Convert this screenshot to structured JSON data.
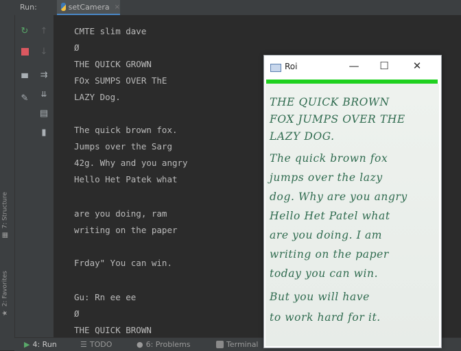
{
  "run_bar": {
    "label": "Run:",
    "tab_title": "setCamera",
    "tab_close": "×"
  },
  "side_tabs": {
    "structure": "7: Structure",
    "favorites": "2: Favorites"
  },
  "console": {
    "lines": [
      "CMTE slim dave",
      "Ø",
      "THE QUICK GROWN",
      "FOx SUMPS OVER ThE",
      "LAZY Dog.",
      "",
      "The quick brown fox.",
      "Jumps over the Sarg",
      "42g. Why and you angry",
      "Hello Het Patek what",
      "",
      "are you doing, ram",
      "writing on the paper",
      "",
      "Frday\" You can win.",
      "",
      "Gu: Rn ee ee",
      "Ø",
      "THE QUICK BROWN"
    ]
  },
  "bottom_tabs": {
    "run": "4: Run",
    "todo": "TODO",
    "problems": "6: Problems",
    "terminal": "Terminal"
  },
  "roi_window": {
    "title": "Roi",
    "minimize": "—",
    "maximize": "☐",
    "close": "✕",
    "handwriting": [
      "THE QUICK BROWN",
      "FOX JUMPS OVER THE",
      "LAZY DOG.",
      "The quick brown fox",
      "jumps over the lazy",
      "dog. Why are you angry",
      "Hello Het Patel what",
      "are you doing. I am",
      "writing on the paper",
      "today you can win.",
      "But you will have",
      "to work hard for it."
    ]
  },
  "colors": {
    "accent": "#4a88c7",
    "rerun": "#59a869",
    "stop": "#db5860",
    "roi_bar": "#1fd11f",
    "ink": "#2f6b4f"
  }
}
